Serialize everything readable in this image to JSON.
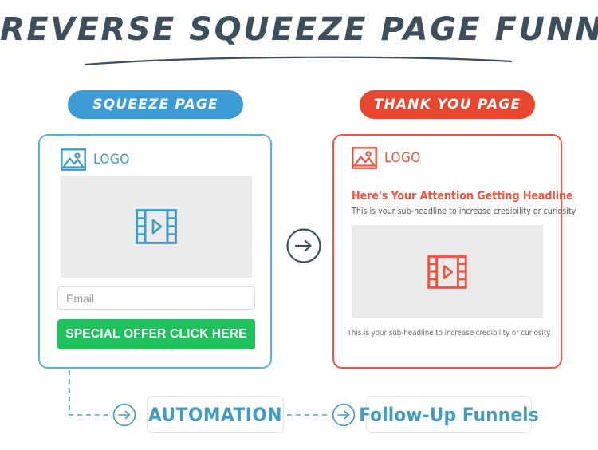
{
  "header": {
    "title": "REVERSE SQUEEZE PAGE FUNNEL"
  },
  "badges": {
    "squeeze": "SQUEEZE PAGE",
    "thank_you": "THANK YOU PAGE"
  },
  "squeeze_page": {
    "logo_label": "LOGO",
    "logo_icon": "image-placeholder-icon",
    "video_icon": "film-strip-play-icon",
    "email_placeholder": "Email",
    "email_value": "",
    "cta_label": "SPECIAL OFFER CLICK HERE",
    "accent_color": "#56b4d3",
    "cta_color": "#1ec25c"
  },
  "thank_you_page": {
    "logo_label": "LOGO",
    "logo_icon": "image-placeholder-icon",
    "headline": "Here's Your Attention Getting Headline",
    "subheadline": "This is your sub-headline to increase credibility or curiosity",
    "video_icon": "film-strip-play-icon",
    "subheadline_bottom": "This is your sub-headline to increase credibility or curiosity",
    "accent_color": "#f4533f"
  },
  "flow": {
    "main_arrow_icon": "circle-arrow-right-icon",
    "step_arrow_icon": "circle-arrow-right-icon",
    "automation_label": "AUTOMATION",
    "followup_label": "Follow-Up Funnels",
    "line_color": "#4aa8cc"
  }
}
